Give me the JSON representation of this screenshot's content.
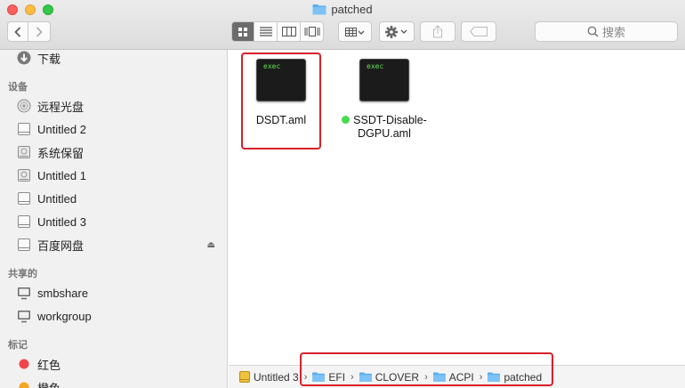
{
  "window": {
    "title": "patched"
  },
  "toolbar": {
    "search_placeholder": "搜索"
  },
  "sidebar": {
    "top_item": "下载",
    "sections": [
      {
        "heading": "设备",
        "items": [
          "远程光盘",
          "Untitled 2",
          "系统保留",
          "Untitled 1",
          "Untitled",
          "Untitled 3",
          "百度网盘"
        ]
      },
      {
        "heading": "共享的",
        "items": [
          "smbshare",
          "workgroup"
        ]
      },
      {
        "heading": "标记",
        "items": [
          "红色",
          "橙色"
        ]
      }
    ],
    "tag_colors": {
      "red": "#f0464b",
      "orange": "#f5a623"
    }
  },
  "files": [
    {
      "name": "DSDT.aml",
      "icon_text": "exec",
      "tag": null
    },
    {
      "name_line1": "SSDT-Disable-",
      "name_line2": "DGPU.aml",
      "icon_text": "exec",
      "tag": "green"
    }
  ],
  "pathbar": {
    "segments": [
      "Untitled 3",
      "EFI",
      "CLOVER",
      "ACPI",
      "patched"
    ]
  },
  "colors": {
    "highlight_box": "#d9202a",
    "folder_blue": "#5aaef0",
    "tag_green": "#47d94e"
  }
}
